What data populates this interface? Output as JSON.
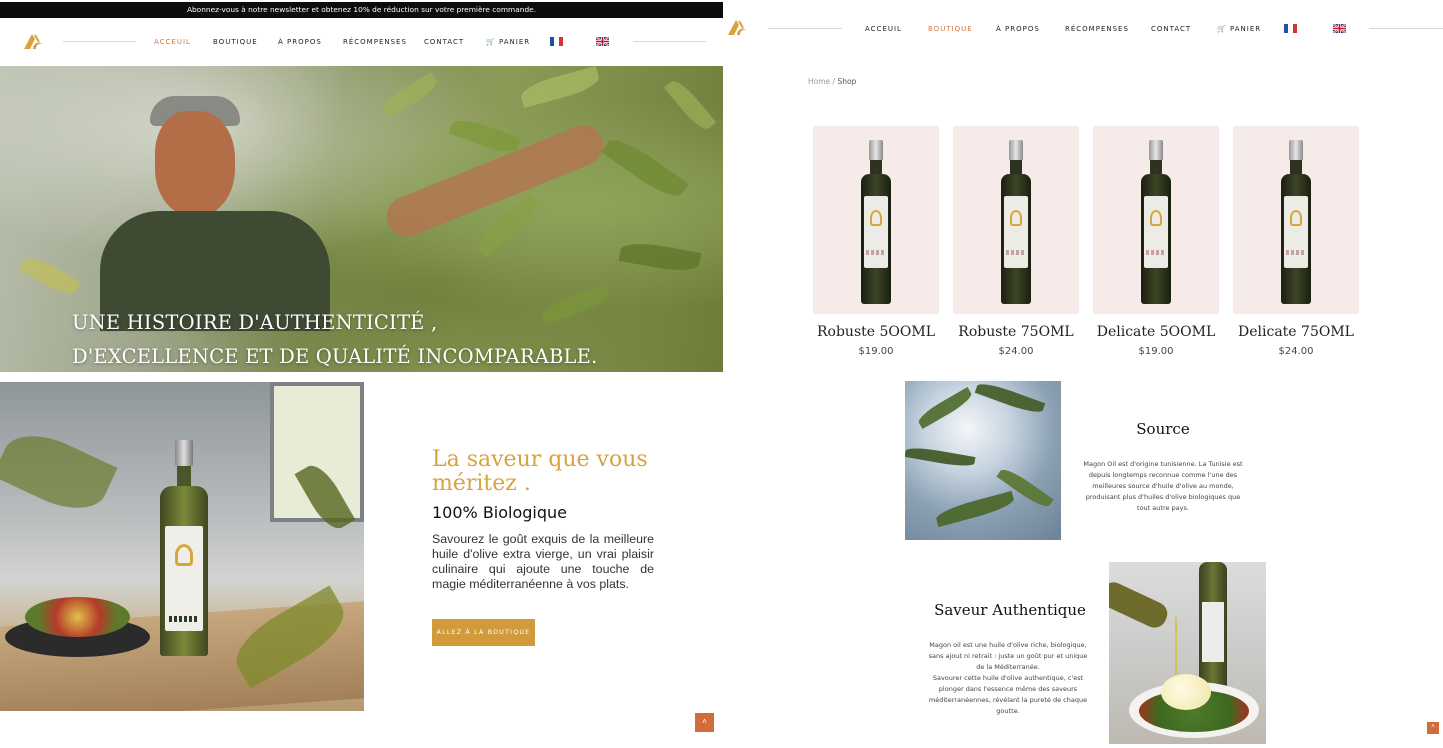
{
  "brand": {
    "accent": "#d27a3c",
    "gold": "#d9a23f",
    "button": "#d19a3a"
  },
  "announcement": "Abonnez-vous à notre newsletter et obtenez 10% de réduction sur votre première commande.",
  "nav": {
    "items": [
      "ACCEUIL",
      "BOUTIQUE",
      "À PROPOS",
      "RÉCOMPENSES",
      "CONTACT",
      "PANIER"
    ],
    "cart_icon": "cart-icon",
    "languages": [
      "fr-flag-icon",
      "en-flag-icon"
    ]
  },
  "home": {
    "hero_line1": "UNE HISTOIRE D'AUTHENTICITÉ ,",
    "hero_line2": "D'EXCELLENCE ET DE QUALITÉ INCOMPARABLE.",
    "flavor_heading": "La saveur que vous méritez .",
    "flavor_sub": "100% Biologique",
    "flavor_text": "Savourez le goût exquis de la meilleure huile d'olive extra vierge, un vrai plaisir culinaire qui ajoute une touche de magie méditerranéenne à vos plats.",
    "shop_button": "ALLEZ À LA BOUTIQUE",
    "scroll_top_icon": "chevron-up-icon"
  },
  "shop": {
    "breadcrumb": {
      "home": "Home",
      "sep": "/",
      "current": "Shop"
    },
    "products": [
      {
        "name": "Robuste 5OOML",
        "price": "$19.00"
      },
      {
        "name": "Robuste 75OML",
        "price": "$24.00"
      },
      {
        "name": "Delicate 5OOML",
        "price": "$19.00"
      },
      {
        "name": "Delicate 75OML",
        "price": "$24.00"
      }
    ],
    "source_title": "Source",
    "source_text": "Magon Oil est d'origine tunisienne. La Tunisie est depuis longtemps reconnue comme l'une des meilleures source d'huile d'olive au monde, produisant plus d'huiles d'olive biologiques que tout autre pays.",
    "auth_title": "Saveur Authentique",
    "auth_text_1": "Magon oil est une huile d'olive riche, biologique, sans ajout ni retrait : juste un goût pur et unique de la Méditerranée.",
    "auth_text_2": "Savourer cette huile d'olive authentique, c'est plonger dans l'essence même des saveurs méditerranéennes, révélant la pureté de chaque goutte."
  }
}
